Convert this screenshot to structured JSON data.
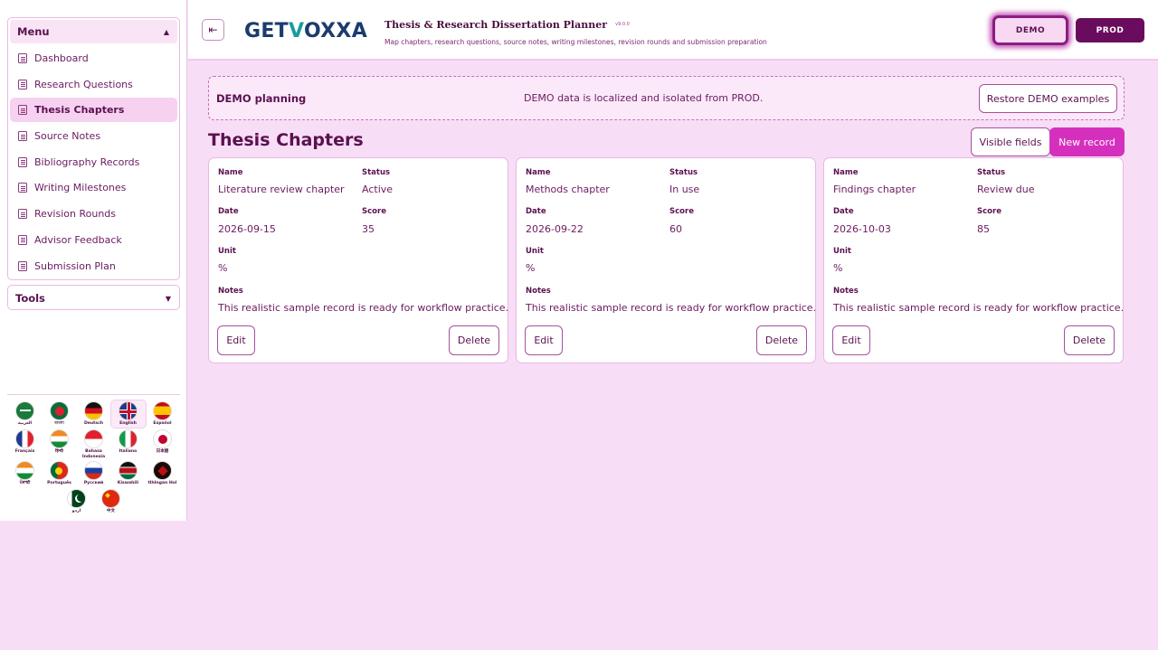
{
  "sidebar": {
    "menu_title": "Menu",
    "tools_title": "Tools",
    "items": [
      {
        "label": "Dashboard"
      },
      {
        "label": "Research Questions"
      },
      {
        "label": "Thesis Chapters"
      },
      {
        "label": "Source Notes"
      },
      {
        "label": "Bibliography Records"
      },
      {
        "label": "Writing Milestones"
      },
      {
        "label": "Revision Rounds"
      },
      {
        "label": "Advisor Feedback"
      },
      {
        "label": "Submission Plan"
      }
    ],
    "active_item": "Thesis Chapters"
  },
  "languages": [
    {
      "label": "العربية"
    },
    {
      "label": "বাংলা"
    },
    {
      "label": "Deutsch"
    },
    {
      "label": "English"
    },
    {
      "label": "Español"
    },
    {
      "label": "Français"
    },
    {
      "label": "हिन्दी"
    },
    {
      "label": "Bahasa Indonesia"
    },
    {
      "label": "Italiano"
    },
    {
      "label": "日本語"
    },
    {
      "label": "ਪੰਜਾਬੀ"
    },
    {
      "label": "Português"
    },
    {
      "label": "Русский"
    },
    {
      "label": "Kiswahili"
    },
    {
      "label": "tlhIngan Hol"
    },
    {
      "label": "اردو"
    },
    {
      "label": "中文"
    }
  ],
  "selected_language": "English",
  "header": {
    "logo_prefix": "GET",
    "logo_v": "V",
    "logo_suffix": "OXXA",
    "title": "Thesis & Research Dissertation Planner",
    "version": "v9.0.0",
    "subtitle": "Map chapters, research questions, source notes, writing milestones, revision rounds and submission preparation",
    "demo_label": "DEMO",
    "prod_label": "PROD",
    "collapse_icon": "sidebar-collapse-icon"
  },
  "notice": {
    "title": "DEMO planning",
    "text": "DEMO data is localized and isolated from PROD.",
    "restore_label": "Restore DEMO examples"
  },
  "section": {
    "title": "Thesis Chapters",
    "visible_fields_label": "Visible fields",
    "new_record_label": "New record"
  },
  "field_labels": {
    "name": "Name",
    "status": "Status",
    "date": "Date",
    "score": "Score",
    "unit": "Unit",
    "notes": "Notes"
  },
  "records": [
    {
      "name": "Literature review chapter",
      "status": "Active",
      "date": "2026-09-15",
      "score": "35",
      "unit": "%",
      "notes": "This realistic sample record is ready for workflow practice.",
      "edit_label": "Edit",
      "delete_label": "Delete"
    },
    {
      "name": "Methods chapter",
      "status": "In use",
      "date": "2026-09-22",
      "score": "60",
      "unit": "%",
      "notes": "This realistic sample record is ready for workflow practice.",
      "edit_label": "Edit",
      "delete_label": "Delete"
    },
    {
      "name": "Findings chapter",
      "status": "Review due",
      "date": "2026-10-03",
      "score": "85",
      "unit": "%",
      "notes": "This realistic sample record is ready for workflow practice.",
      "edit_label": "Edit",
      "delete_label": "Delete"
    }
  ],
  "colors": {
    "accent": "#d530bd",
    "primary_dark": "#6a0c5e",
    "background": "#f8ddf6"
  }
}
